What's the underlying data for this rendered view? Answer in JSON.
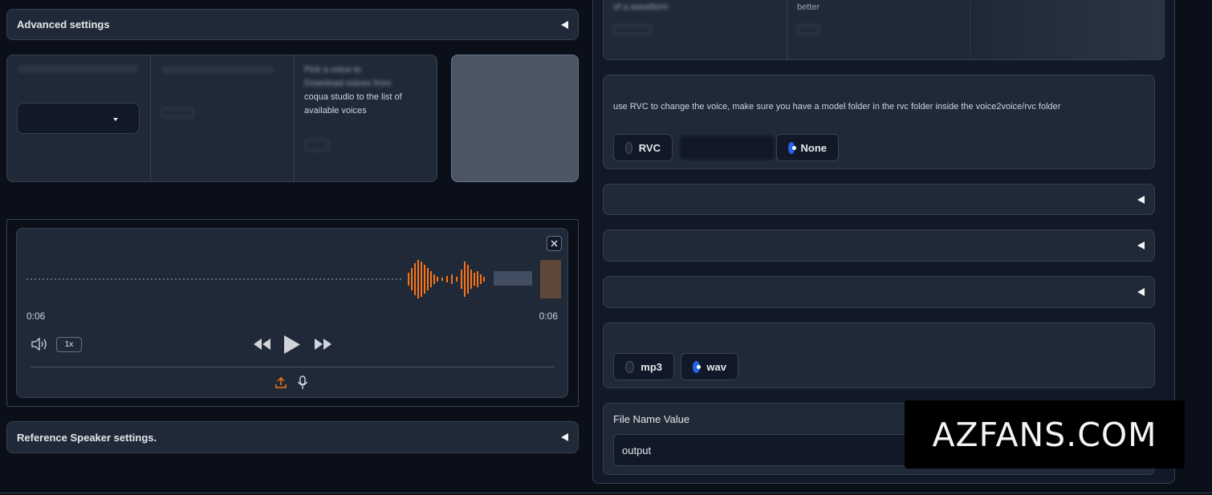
{
  "left": {
    "advanced_settings": "Advanced settings",
    "voice_desc": {
      "prefix": "Pick a voice to",
      "mid": "Download voices from",
      "line3": "coqua studio to the list of",
      "line4": "available voices"
    },
    "player": {
      "time_current": "0:06",
      "time_total": "0:06",
      "speed": "1x"
    },
    "reference_speaker": "Reference Speaker settings."
  },
  "right": {
    "top_table": {
      "cell1": "of a waveform",
      "cell2": "better"
    },
    "rvc": {
      "description": "use RVC to change the voice, make sure you have a model folder in the rvc folder inside the voice2voice/rvc folder",
      "options": [
        "RVC",
        "None"
      ],
      "selected": "None"
    },
    "format": {
      "options": [
        "mp3",
        "wav"
      ],
      "selected": "wav"
    },
    "file_name": {
      "label": "File Name Value",
      "value": "output"
    }
  },
  "watermark": "AZFANS.COM",
  "colors": {
    "accent_orange": "#f97316",
    "radio_blue": "#2563eb",
    "panel": "#1f2937",
    "background": "#0b0f19"
  }
}
